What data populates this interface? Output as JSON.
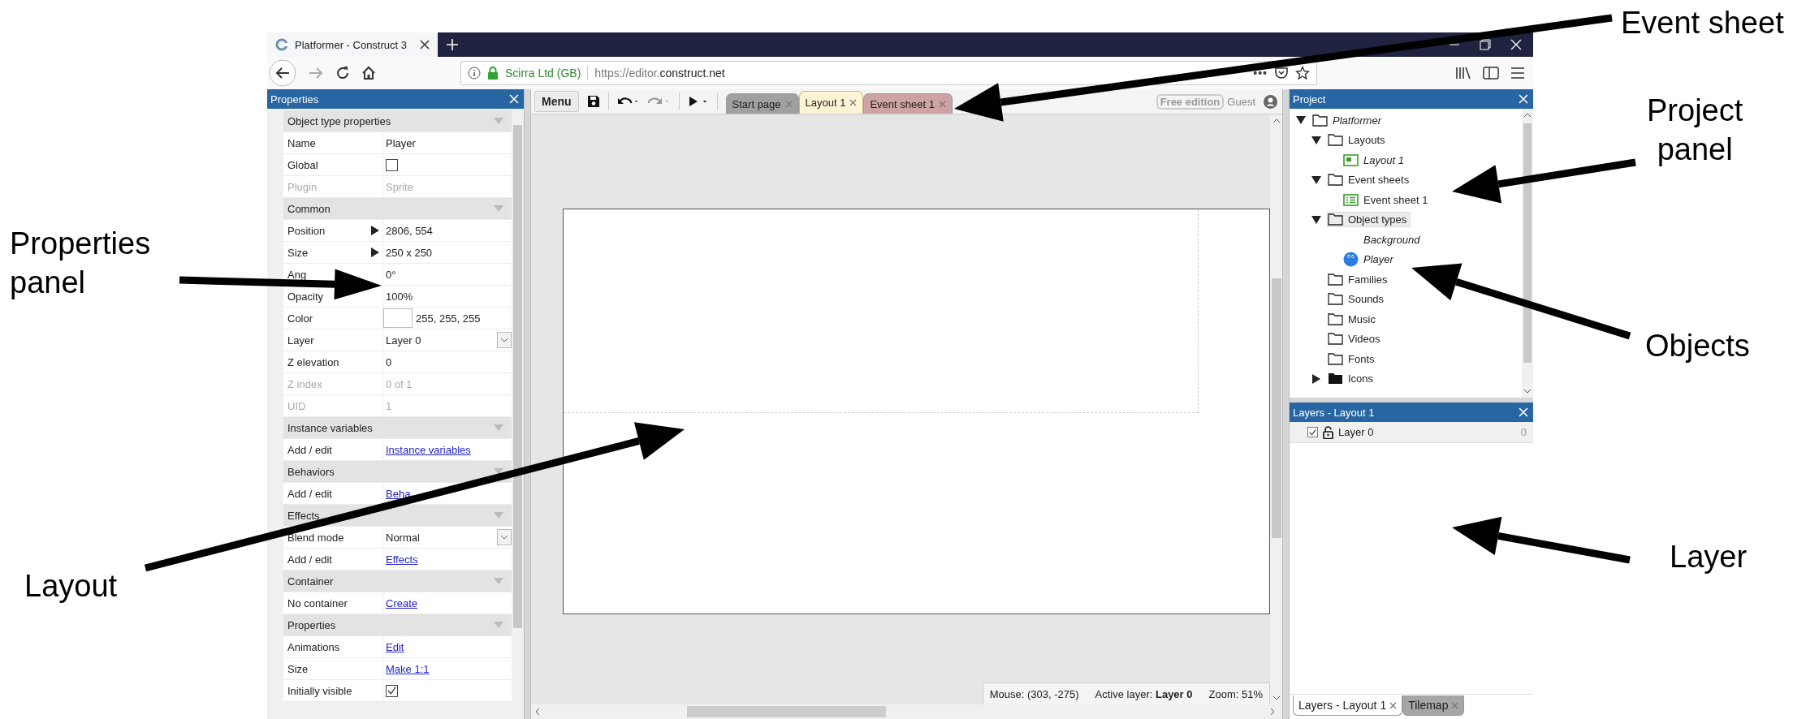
{
  "annotations": [
    {
      "lines": [
        "Event sheet"
      ]
    },
    {
      "lines": [
        "Project",
        "panel"
      ]
    },
    {
      "lines": [
        "Properties",
        "panel"
      ]
    },
    {
      "lines": [
        "Objects"
      ]
    },
    {
      "lines": [
        "Layout"
      ]
    },
    {
      "lines": [
        "Layer"
      ]
    }
  ],
  "browser": {
    "tab_title": "Platformer - Construct 3",
    "url_owner": "Scirra Ltd (GB)",
    "url_prefix": "https://editor.",
    "url_domain": "construct.net",
    "page_actions": "•••"
  },
  "properties": {
    "title": "Properties",
    "sections": [
      {
        "title": "Object type properties",
        "rows": [
          {
            "label": "Name",
            "kind": "text",
            "value": "Player",
            "disabled": false
          },
          {
            "label": "Global",
            "kind": "checkbox",
            "checked": false,
            "disabled": false
          },
          {
            "label": "Plugin",
            "kind": "text",
            "value": "Sprite",
            "disabled": true
          }
        ]
      },
      {
        "title": "Common",
        "rows": [
          {
            "label": "Position",
            "kind": "expandable",
            "value": "2806, 554",
            "disabled": false
          },
          {
            "label": "Size",
            "kind": "expandable",
            "value": "250 x 250",
            "disabled": false
          },
          {
            "label": "Ang",
            "kind": "text",
            "value": "0°",
            "disabled": false
          },
          {
            "label": "Opacity",
            "kind": "text",
            "value": "100%",
            "disabled": false
          },
          {
            "label": "Color",
            "kind": "color",
            "color": "#ffffff",
            "value": "255, 255, 255",
            "disabled": false
          },
          {
            "label": "Layer",
            "kind": "dropdown",
            "value": "Layer 0",
            "disabled": false
          },
          {
            "label": "Z elevation",
            "kind": "text",
            "value": "0",
            "disabled": false
          },
          {
            "label": "Z index",
            "kind": "text",
            "value": "0 of 1",
            "disabled": true
          },
          {
            "label": "UID",
            "kind": "text",
            "value": "1",
            "disabled": true
          }
        ]
      },
      {
        "title": "Instance variables",
        "rows": [
          {
            "label": "Add / edit",
            "kind": "link",
            "value": "Instance variables",
            "disabled": false
          }
        ]
      },
      {
        "title": "Behaviors",
        "rows": [
          {
            "label": "Add / edit",
            "kind": "link",
            "value": "Beha",
            "disabled": false
          }
        ]
      },
      {
        "title": "Effects",
        "rows": [
          {
            "label": "Blend mode",
            "kind": "dropdown",
            "value": "Normal",
            "disabled": false
          },
          {
            "label": "Add / edit",
            "kind": "link",
            "value": "Effects",
            "disabled": false
          }
        ]
      },
      {
        "title": "Container",
        "rows": [
          {
            "label": "No container",
            "kind": "link",
            "value": "Create",
            "disabled": false
          }
        ]
      },
      {
        "title": "Properties",
        "rows": [
          {
            "label": "Animations",
            "kind": "link",
            "value": "Edit",
            "disabled": false
          },
          {
            "label": "Size",
            "kind": "link",
            "value": "Make 1:1",
            "disabled": false
          },
          {
            "label": "Initially visible",
            "kind": "checkbox",
            "checked": true,
            "disabled": false
          }
        ]
      }
    ]
  },
  "toolbar": {
    "menu": "Menu",
    "edition": "Free edition",
    "user": "Guest"
  },
  "editor_tabs": [
    {
      "label": "Start page",
      "color": "#a0a0a0",
      "selected": false
    },
    {
      "label": "Layout 1",
      "color": "#fdf4d6",
      "selected": true
    },
    {
      "label": "Event sheet 1",
      "color": "#cfa3a3",
      "selected": false
    }
  ],
  "status": {
    "mouse": "Mouse: (303, -275)",
    "active_layer": "Active layer: **Layer 0**",
    "zoom": "Zoom: 51%"
  },
  "project": {
    "title": "Project",
    "tree": [
      {
        "label": "Platformer",
        "kind": "folder",
        "italic": true,
        "selected": false,
        "expanded": true,
        "children": [
          {
            "label": "Layouts",
            "kind": "folder",
            "italic": false,
            "selected": false,
            "expanded": true,
            "children": [
              {
                "label": "Layout 1",
                "kind": "layout",
                "italic": true,
                "selected": false
              }
            ]
          },
          {
            "label": "Event sheets",
            "kind": "folder",
            "italic": false,
            "selected": false,
            "expanded": true,
            "children": [
              {
                "label": "Event sheet 1",
                "kind": "event-sheet",
                "italic": false,
                "selected": false
              }
            ]
          },
          {
            "label": "Object types",
            "kind": "folder",
            "italic": false,
            "selected": true,
            "expanded": true,
            "children": [
              {
                "label": "Background",
                "kind": "none",
                "italic": true,
                "selected": false
              },
              {
                "label": "Player",
                "kind": "sprite",
                "italic": true,
                "selected": false
              }
            ]
          },
          {
            "label": "Families",
            "kind": "folder",
            "italic": false,
            "selected": false
          },
          {
            "label": "Sounds",
            "kind": "folder",
            "italic": false,
            "selected": false
          },
          {
            "label": "Music",
            "kind": "folder",
            "italic": false,
            "selected": false
          },
          {
            "label": "Videos",
            "kind": "folder",
            "italic": false,
            "selected": false
          },
          {
            "label": "Fonts",
            "kind": "folder",
            "italic": false,
            "selected": false
          },
          {
            "label": "Icons",
            "kind": "folder-filled",
            "italic": false,
            "selected": false,
            "expanded": false
          }
        ]
      }
    ]
  },
  "layers": {
    "title": "Layers - Layout 1",
    "rows": [
      {
        "name": "Layer 0",
        "visible": true,
        "count": "0"
      }
    ]
  },
  "bottom_tabs": [
    {
      "label": "Layers - Layout 1",
      "selected": true
    },
    {
      "label": "Tilemap",
      "selected": false
    }
  ]
}
